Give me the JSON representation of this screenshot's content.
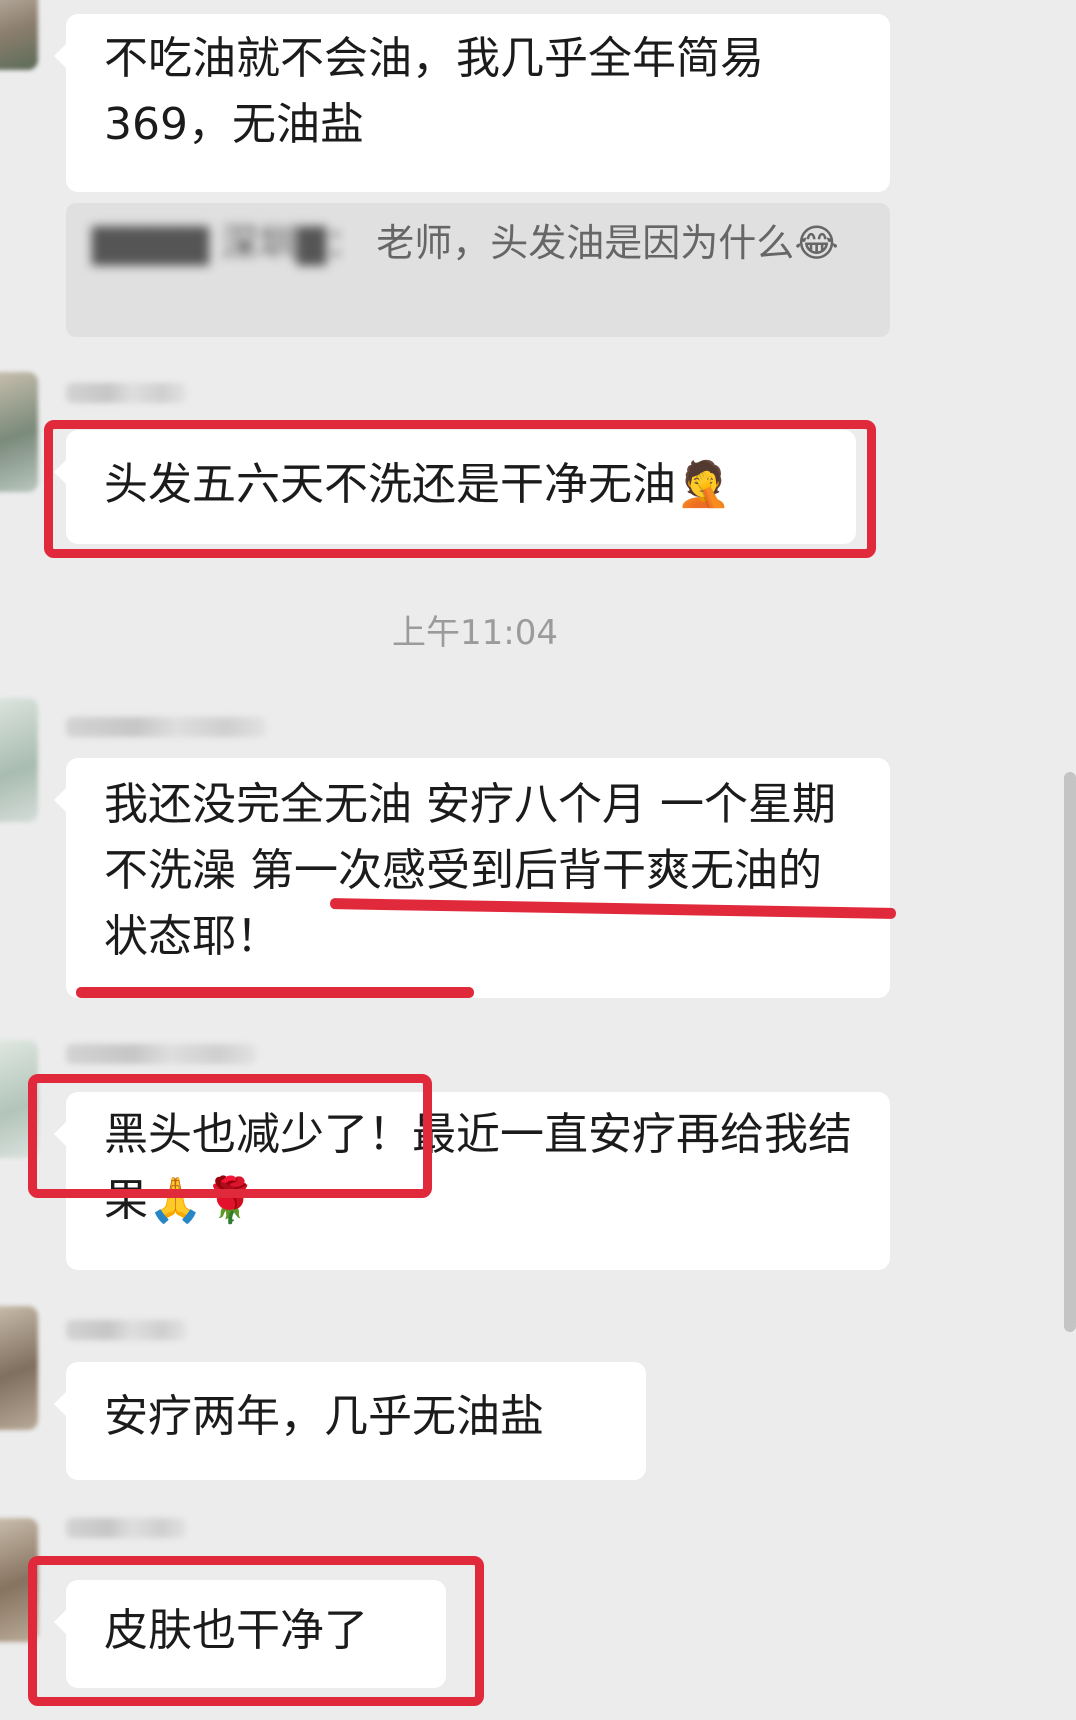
{
  "messages": [
    {
      "text": "不吃油就不会油，我几乎全年简易369，无油盐"
    },
    {
      "quote_prefix": "▇▇▇▇ 深圳▇：",
      "quote": "老师，头发油是因为什么",
      "quote_emoji": "😂"
    },
    {
      "text": "头发五六天不洗还是干净无油",
      "emoji": "🤦"
    },
    {
      "text": "我还没完全无油 安疗八个月 一个星期不洗澡 第一次感受到后背干爽无油的状态耶！"
    },
    {
      "text": "黑头也减少了！最近一直安疗再给我结果",
      "emoji": "🙏🌹"
    },
    {
      "text": "安疗两年，几乎无油盐"
    },
    {
      "text": "皮肤也干净了"
    }
  ],
  "timestamp": "上午11:04",
  "colors": {
    "highlight": "#e0293b",
    "bubble": "#ffffff",
    "background": "#ececec"
  }
}
